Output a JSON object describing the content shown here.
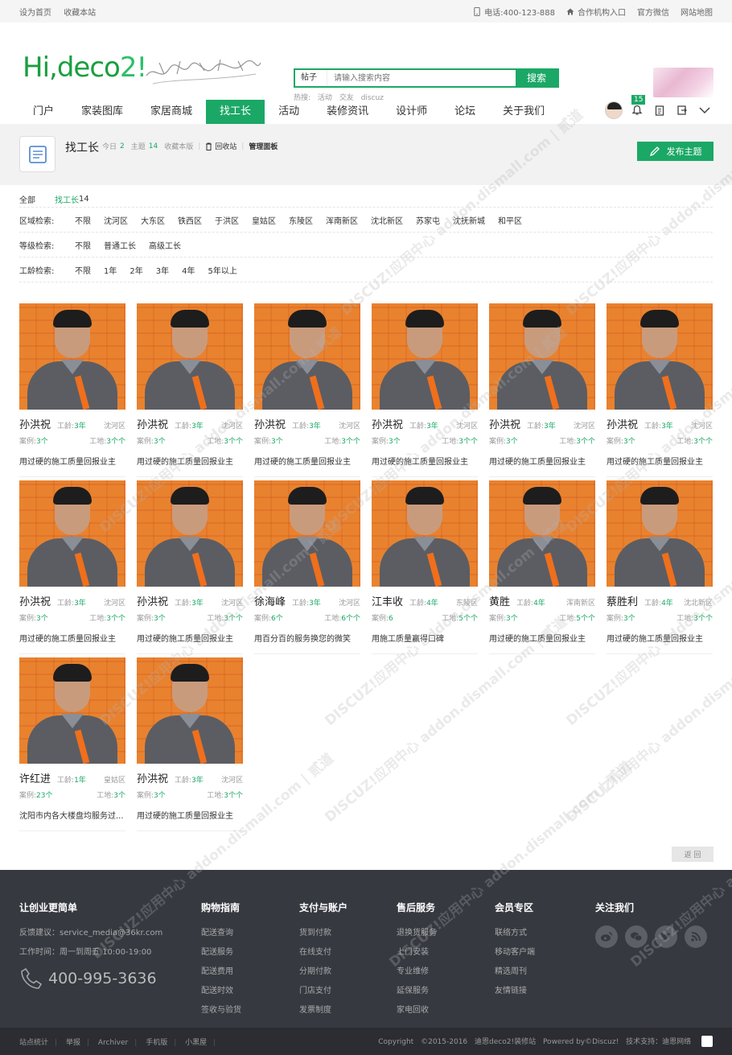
{
  "topbar": {
    "left": [
      "设为首页",
      "收藏本站"
    ],
    "phone": "电话:400-123-888",
    "partner": "合作机构入口",
    "wechat": "官方微信",
    "sitemap": "网站地图"
  },
  "header": {
    "logo_main": "Hi,deco",
    "logo_num": "2!",
    "search_type": "帖子",
    "search_placeholder": "请输入搜索内容",
    "search_button": "搜索",
    "hot_label": "热搜:",
    "hot_items": [
      "活动",
      "交友",
      "discuz"
    ]
  },
  "nav": {
    "items": [
      "门户",
      "家装图库",
      "家居商城",
      "找工长",
      "活动",
      "装修资讯",
      "设计师",
      "论坛",
      "关于我们"
    ],
    "active_index": 3,
    "notice_count": "15"
  },
  "forum": {
    "title": "找工长",
    "today_label": "今日",
    "today_count": "2",
    "topic_label": "主题",
    "topic_count": "14",
    "fav_label": "收藏本版",
    "recycle": "回收站",
    "manage": "管理面板",
    "post_button": "发布主题"
  },
  "filters": {
    "all_label": "全部",
    "active_label": "找工长",
    "active_count": "14",
    "area_label": "区域检索:",
    "area_options": [
      "不限",
      "沈河区",
      "大东区",
      "铁西区",
      "于洪区",
      "皇姑区",
      "东陵区",
      "浑南新区",
      "沈北新区",
      "苏家屯",
      "沈抚新城",
      "和平区"
    ],
    "level_label": "等级检索:",
    "level_options": [
      "不限",
      "普通工长",
      "高级工长"
    ],
    "years_label": "工龄检索:",
    "years_options": [
      "不限",
      "1年",
      "2年",
      "3年",
      "4年",
      "5年以上"
    ]
  },
  "cards": [
    {
      "name": "孙洪祝",
      "years_label": "工龄:",
      "years": "3年",
      "area": "沈河区",
      "cases_label": "案例:",
      "cases": "3个",
      "sites_label": "工地:",
      "sites": "3个个",
      "desc": "用过硬的施工质量回报业主"
    },
    {
      "name": "孙洪祝",
      "years_label": "工龄:",
      "years": "3年",
      "area": "沈河区",
      "cases_label": "案例:",
      "cases": "3个",
      "sites_label": "工地:",
      "sites": "3个个",
      "desc": "用过硬的施工质量回报业主"
    },
    {
      "name": "孙洪祝",
      "years_label": "工龄:",
      "years": "3年",
      "area": "沈河区",
      "cases_label": "案例:",
      "cases": "3个",
      "sites_label": "工地:",
      "sites": "3个个",
      "desc": "用过硬的施工质量回报业主"
    },
    {
      "name": "孙洪祝",
      "years_label": "工龄:",
      "years": "3年",
      "area": "沈河区",
      "cases_label": "案例:",
      "cases": "3个",
      "sites_label": "工地:",
      "sites": "3个个",
      "desc": "用过硬的施工质量回报业主"
    },
    {
      "name": "孙洪祝",
      "years_label": "工龄:",
      "years": "3年",
      "area": "沈河区",
      "cases_label": "案例:",
      "cases": "3个",
      "sites_label": "工地:",
      "sites": "3个个",
      "desc": "用过硬的施工质量回报业主"
    },
    {
      "name": "孙洪祝",
      "years_label": "工龄:",
      "years": "3年",
      "area": "沈河区",
      "cases_label": "案例:",
      "cases": "3个",
      "sites_label": "工地:",
      "sites": "3个个",
      "desc": "用过硬的施工质量回报业主"
    },
    {
      "name": "孙洪祝",
      "years_label": "工龄:",
      "years": "3年",
      "area": "沈河区",
      "cases_label": "案例:",
      "cases": "3个",
      "sites_label": "工地:",
      "sites": "3个个",
      "desc": "用过硬的施工质量回报业主"
    },
    {
      "name": "孙洪祝",
      "years_label": "工龄:",
      "years": "3年",
      "area": "沈河区",
      "cases_label": "案例:",
      "cases": "3个",
      "sites_label": "工地:",
      "sites": "3个个",
      "desc": "用过硬的施工质量回报业主"
    },
    {
      "name": "徐海峰",
      "years_label": "工龄:",
      "years": "3年",
      "area": "沈河区",
      "cases_label": "案例:",
      "cases": "6个",
      "sites_label": "工地:",
      "sites": "6个个",
      "desc": "用百分百的服务换您的微笑"
    },
    {
      "name": "江丰收",
      "years_label": "工龄:",
      "years": "4年",
      "area": "东陵区",
      "cases_label": "案例:",
      "cases": "6",
      "sites_label": "工地:",
      "sites": "5个个",
      "desc": "用施工质量赢得口碑"
    },
    {
      "name": "黄胜",
      "years_label": "工龄:",
      "years": "4年",
      "area": "浑南新区",
      "cases_label": "案例:",
      "cases": "3个",
      "sites_label": "工地:",
      "sites": "5个个",
      "desc": "用过硬的施工质量回报业主"
    },
    {
      "name": "蔡胜利",
      "years_label": "工龄:",
      "years": "4年",
      "area": "沈北新区",
      "cases_label": "案例:",
      "cases": "3个",
      "sites_label": "工地:",
      "sites": "3个个",
      "desc": "用过硬的施工质量回报业主"
    },
    {
      "name": "许红进",
      "years_label": "工龄:",
      "years": "1年",
      "area": "皇姑区",
      "cases_label": "案例:",
      "cases": "23个",
      "sites_label": "工地:",
      "sites": "3个",
      "desc": "沈阳市内各大楼盘均服务过..."
    },
    {
      "name": "孙洪祝",
      "years_label": "工龄:",
      "years": "3年",
      "area": "沈河区",
      "cases_label": "案例:",
      "cases": "3个",
      "sites_label": "工地:",
      "sites": "3个个",
      "desc": "用过硬的施工质量回报业主"
    }
  ],
  "back_top": "返 回",
  "footer": {
    "col1_title": "让创业更简单",
    "feedback": "反馈建议：service_media@36kr.com",
    "hours": "工作时间：周一到周五 10:00-19:00",
    "phone": "400-995-3636",
    "col2_title": "购物指南",
    "col2_items": [
      "配送查询",
      "配送服务",
      "配送费用",
      "配送时效",
      "签收与验货"
    ],
    "col3_title": "支付与账户",
    "col3_items": [
      "货到付款",
      "在线支付",
      "分期付款",
      "门店支付",
      "发票制度"
    ],
    "col4_title": "售后服务",
    "col4_items": [
      "退换货服务",
      "上门安装",
      "专业维修",
      "延保服务",
      "家电回收"
    ],
    "col5_title": "会员专区",
    "col5_items": [
      "联络方式",
      "移动客户端",
      "精选周刊",
      "友情链接"
    ],
    "col6_title": "关注我们"
  },
  "bottombar": {
    "links": [
      "站点统计",
      "举报",
      "Archiver",
      "手机版",
      "小黑屋"
    ],
    "copyright": "Copyright",
    "years": "©2015-2016",
    "site": "迪恩deco2!装修站",
    "powered": "Powered by©Discuz!",
    "support": "技术支持：迪恩网络"
  },
  "watermark": "DISCUZ!应用中心 addon.dismall.com | 贰道"
}
